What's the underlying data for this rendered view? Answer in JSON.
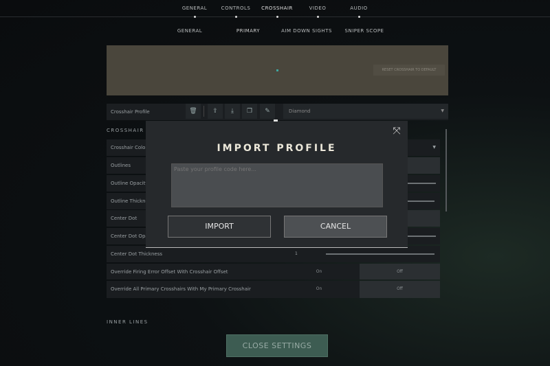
{
  "top_tabs": [
    {
      "label": "GENERAL"
    },
    {
      "label": "CONTROLS"
    },
    {
      "label": "CROSSHAIR",
      "active": true
    },
    {
      "label": "VIDEO"
    },
    {
      "label": "AUDIO"
    }
  ],
  "sub_tabs": [
    {
      "label": "GENERAL"
    },
    {
      "label": "PRIMARY",
      "active": true
    },
    {
      "label": "AIM DOWN SIGHTS"
    },
    {
      "label": "SNIPER SCOPE"
    }
  ],
  "preview": {
    "reset_label": "RESET CROSSHAIR TO DEFAULT",
    "crosshair_color": "#3fa7a0"
  },
  "profile": {
    "label": "Crosshair Profile",
    "selected": "Diamond",
    "icons": [
      "delete-icon",
      "export-icon",
      "import-icon",
      "copy-icon",
      "rename-icon"
    ]
  },
  "sections": {
    "crosshair": "CROSSHAIR",
    "inner_lines": "INNER LINES"
  },
  "rows": [
    {
      "label": "Crosshair Color"
    },
    {
      "label": "Outlines"
    },
    {
      "label": "Outline Opacity"
    },
    {
      "label": "Outline Thickness"
    },
    {
      "label": "Center Dot"
    },
    {
      "label": "Center Dot Opacity"
    },
    {
      "label": "Center Dot Thickness",
      "value": "1"
    },
    {
      "label": "Override Firing Error Offset With Crosshair Offset",
      "on": "On",
      "off": "Off",
      "selected": "Off"
    },
    {
      "label": "Override All Primary Crosshairs With My Primary Crosshair",
      "on": "On",
      "off": "Off",
      "selected": "Off"
    }
  ],
  "modal": {
    "title": "IMPORT PROFILE",
    "placeholder": "Paste your profile code here...",
    "import_label": "IMPORT",
    "cancel_label": "CANCEL"
  },
  "close_settings_label": "CLOSE SETTINGS",
  "colors": {
    "accent": "#3d5c52",
    "modal_bg": "#26292c"
  }
}
